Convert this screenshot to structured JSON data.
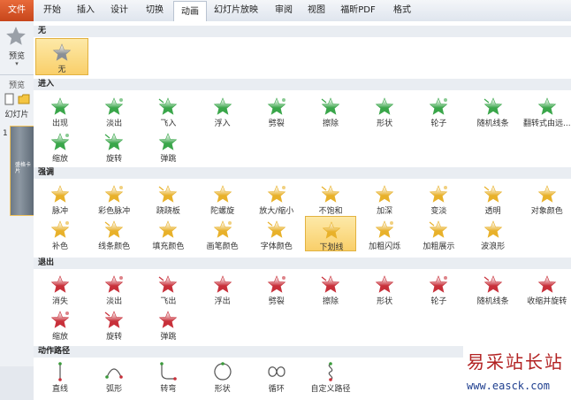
{
  "tabs": [
    {
      "label": "文件",
      "kind": "file"
    },
    {
      "label": "开始",
      "kind": "normal"
    },
    {
      "label": "插入",
      "kind": "normal"
    },
    {
      "label": "设计",
      "kind": "normal"
    },
    {
      "label": "切换",
      "kind": "normal"
    },
    {
      "label": "动画",
      "kind": "active"
    },
    {
      "label": "幻灯片放映",
      "kind": "normal"
    },
    {
      "label": "审阅",
      "kind": "normal"
    },
    {
      "label": "视图",
      "kind": "normal"
    },
    {
      "label": "福昕PDF",
      "kind": "normal"
    },
    {
      "label": "格式",
      "kind": "normal"
    }
  ],
  "left": {
    "preview_label": "预览",
    "preview_group": "预览",
    "slides_tab": "幻灯片",
    "slide_number": "1",
    "thumb_text": "盛格卡片"
  },
  "colors": {
    "entrance": "#3aa64a",
    "emphasis": "#e8b12a",
    "exit": "#c8303a",
    "path": "#3f8f3f",
    "none": "#8a8f96"
  },
  "sections": {
    "none": {
      "title": "无",
      "items": [
        {
          "label": "无",
          "icon": "star-none-icon"
        }
      ]
    },
    "entrance": {
      "title": "进入",
      "items": [
        {
          "label": "出现",
          "icon": "star-icon"
        },
        {
          "label": "淡出",
          "icon": "star-icon"
        },
        {
          "label": "飞入",
          "icon": "star-icon"
        },
        {
          "label": "浮入",
          "icon": "star-icon"
        },
        {
          "label": "劈裂",
          "icon": "star-icon"
        },
        {
          "label": "擦除",
          "icon": "star-icon"
        },
        {
          "label": "形状",
          "icon": "star-icon"
        },
        {
          "label": "轮子",
          "icon": "star-icon"
        },
        {
          "label": "随机线条",
          "icon": "star-icon"
        },
        {
          "label": "翻转式由远...",
          "icon": "star-icon"
        },
        {
          "label": "缩放",
          "icon": "star-icon"
        },
        {
          "label": "旋转",
          "icon": "star-icon"
        },
        {
          "label": "弹跳",
          "icon": "star-icon"
        }
      ]
    },
    "emphasis": {
      "title": "强调",
      "items": [
        {
          "label": "脉冲",
          "icon": "star-icon"
        },
        {
          "label": "彩色脉冲",
          "icon": "star-icon"
        },
        {
          "label": "跷跷板",
          "icon": "star-icon"
        },
        {
          "label": "陀螺旋",
          "icon": "star-icon"
        },
        {
          "label": "放大/缩小",
          "icon": "star-icon"
        },
        {
          "label": "不饱和",
          "icon": "star-icon"
        },
        {
          "label": "加深",
          "icon": "star-icon"
        },
        {
          "label": "变淡",
          "icon": "star-icon"
        },
        {
          "label": "透明",
          "icon": "star-icon"
        },
        {
          "label": "对象颜色",
          "icon": "star-icon"
        },
        {
          "label": "补色",
          "icon": "star-icon"
        },
        {
          "label": "线条颜色",
          "icon": "star-icon"
        },
        {
          "label": "填充颜色",
          "icon": "star-icon"
        },
        {
          "label": "画笔颜色",
          "icon": "star-icon"
        },
        {
          "label": "字体颜色",
          "icon": "star-icon"
        },
        {
          "label": "下划线",
          "icon": "star-icon",
          "selected": true
        },
        {
          "label": "加粗闪烁",
          "icon": "star-icon"
        },
        {
          "label": "加粗展示",
          "icon": "star-icon"
        },
        {
          "label": "波浪形",
          "icon": "star-icon"
        }
      ]
    },
    "exit": {
      "title": "退出",
      "items": [
        {
          "label": "消失",
          "icon": "star-icon"
        },
        {
          "label": "淡出",
          "icon": "star-icon"
        },
        {
          "label": "飞出",
          "icon": "star-icon"
        },
        {
          "label": "浮出",
          "icon": "star-icon"
        },
        {
          "label": "劈裂",
          "icon": "star-icon"
        },
        {
          "label": "擦除",
          "icon": "star-icon"
        },
        {
          "label": "形状",
          "icon": "star-icon"
        },
        {
          "label": "轮子",
          "icon": "star-icon"
        },
        {
          "label": "随机线条",
          "icon": "star-icon"
        },
        {
          "label": "收缩并旋转",
          "icon": "star-icon"
        },
        {
          "label": "缩放",
          "icon": "star-icon"
        },
        {
          "label": "旋转",
          "icon": "star-icon"
        },
        {
          "label": "弹跳",
          "icon": "star-icon"
        }
      ]
    },
    "paths": {
      "title": "动作路径",
      "items": [
        {
          "label": "直线",
          "icon": "line-path-icon"
        },
        {
          "label": "弧形",
          "icon": "arc-path-icon"
        },
        {
          "label": "转弯",
          "icon": "turn-path-icon"
        },
        {
          "label": "形状",
          "icon": "circle-path-icon"
        },
        {
          "label": "循环",
          "icon": "loop-path-icon"
        },
        {
          "label": "自定义路径",
          "icon": "custom-path-icon"
        }
      ]
    }
  },
  "watermark": {
    "title": "易采站长站",
    "url": "www.easck.com"
  }
}
